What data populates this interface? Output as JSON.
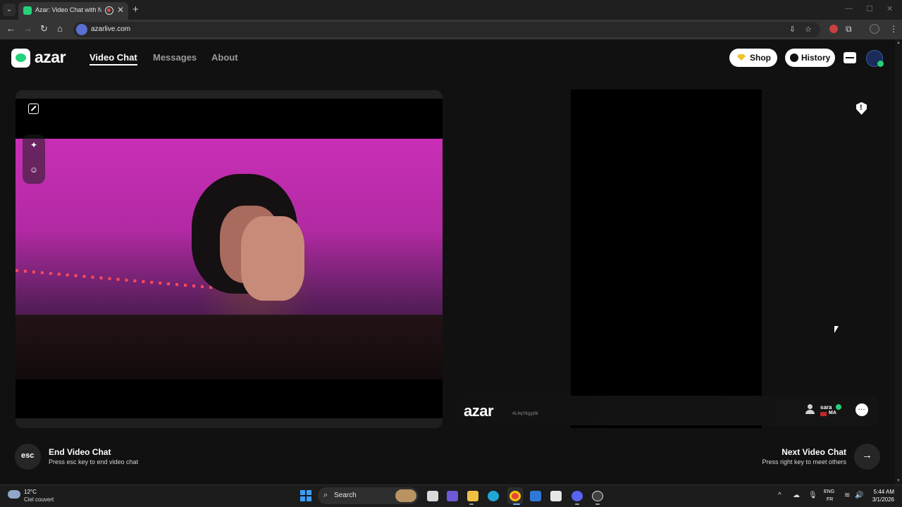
{
  "browser": {
    "tab_title": "Azar: Video Chat with New Pe",
    "url": "azarlive.com",
    "tab_close": "✕",
    "new_tab": "+",
    "window_controls": [
      "—",
      "☐",
      "✕"
    ]
  },
  "header": {
    "logo": "azar",
    "nav": [
      "Video Chat",
      "Messages",
      "About"
    ],
    "active_nav": "Video Chat",
    "shop_label": "Shop",
    "history_label": "History"
  },
  "remote": {
    "watermark": "azar",
    "watermark_id": "4L0qY8ggXN",
    "peer_name": "sara",
    "peer_country": "MA"
  },
  "controls": {
    "esc_label": "esc",
    "end_title": "End Video Chat",
    "end_sub": "Press esc key to end video chat",
    "next_title": "Next Video Chat",
    "next_sub": "Press right key to meet others",
    "next_arrow": "→"
  },
  "taskbar": {
    "weather_temp": "12°C",
    "weather_desc": "Ciel couvert",
    "search_label": "Search",
    "lang_top": "ENG",
    "lang_bottom": "FR",
    "time": "5:44 AM",
    "date": "3/1/2026",
    "chevron": "^"
  },
  "colors": {
    "accent": "#25d07a",
    "background": "#111111",
    "video_magenta": "#c82fb5"
  }
}
